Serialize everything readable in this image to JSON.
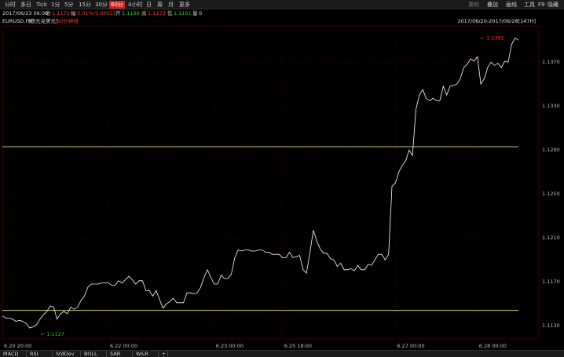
{
  "toolbar": {
    "timeframes": [
      "分时",
      "多日",
      "Tick",
      "1分",
      "5分",
      "15分",
      "30分",
      "60分",
      "4小时",
      "日",
      "周",
      "月",
      "更多"
    ],
    "active_index": 7,
    "right_items": [
      "重权",
      "叠加",
      "画线",
      "工具",
      "F9",
      "隐藏"
    ]
  },
  "info": {
    "datetime": "2017/06/23 06:00",
    "close_label": "收",
    "close_value": "1.1171",
    "change_label": "幅",
    "change_value": "0.01%(0.0001)",
    "open_label": "开",
    "open_value": "1.1169",
    "high_label": "高",
    "high_value": "1.1173",
    "low_label": "低",
    "low_value": "1.1161",
    "volume_label": "量",
    "volume_value": "0"
  },
  "symbol": {
    "code": "EURUSD.FX",
    "name": "[欧元兑美元]",
    "period": "60分钟线"
  },
  "range_text": "2017/06/20-2017/06/28[147H]",
  "chart_data": {
    "type": "line",
    "y_ticks": [
      "1.1370",
      "1.1330",
      "1.1290",
      "1.1250",
      "1.1210",
      "1.1170",
      "1.1130"
    ],
    "x_ticks": [
      "6.20 20:00",
      "6.22 00:00",
      "6.23 00:00",
      "6.25 18:00",
      "6.27 00:00",
      "6.28 00:00"
    ],
    "ylim": [
      1.1118,
      1.1403
    ],
    "high_marker": "1.1392",
    "low_marker": "1.1127",
    "hlines": [
      1.1293,
      1.1144
    ],
    "values": [
      1.1139,
      1.1137,
      1.1137,
      1.1136,
      1.1134,
      1.1135,
      1.1134,
      1.1132,
      1.1128,
      1.1129,
      1.1131,
      1.1136,
      1.114,
      1.1143,
      1.1148,
      1.1147,
      1.1136,
      1.1141,
      1.1143,
      1.1141,
      1.1147,
      1.1145,
      1.1147,
      1.1153,
      1.1157,
      1.1165,
      1.1168,
      1.1168,
      1.1168,
      1.1169,
      1.1169,
      1.1169,
      1.1167,
      1.1167,
      1.1171,
      1.1169,
      1.1172,
      1.1175,
      1.1172,
      1.1168,
      1.1171,
      1.1171,
      1.1162,
      1.1162,
      1.1157,
      1.1162,
      1.1154,
      1.1146,
      1.115,
      1.1152,
      1.1155,
      1.1151,
      1.1151,
      1.1151,
      1.116,
      1.116,
      1.1159,
      1.116,
      1.1165,
      1.1174,
      1.1181,
      1.1174,
      1.1168,
      1.1168,
      1.1176,
      1.1173,
      1.1173,
      1.1177,
      1.1192,
      1.1199,
      1.1198,
      1.1199,
      1.1199,
      1.1198,
      1.1198,
      1.1199,
      1.1199,
      1.1197,
      1.1197,
      1.1195,
      1.1195,
      1.1195,
      1.1192,
      1.1192,
      1.1197,
      1.1192,
      1.1193,
      1.1194,
      1.1181,
      1.1178,
      1.1197,
      1.1217,
      1.1207,
      1.12,
      1.1196,
      1.1196,
      1.1191,
      1.119,
      1.1184,
      1.1187,
      1.1181,
      1.1181,
      1.1182,
      1.118,
      1.1185,
      1.1181,
      1.1181,
      1.1186,
      1.1185,
      1.119,
      1.1195,
      1.1195,
      1.119,
      1.1195,
      1.1257,
      1.126,
      1.127,
      1.1276,
      1.128,
      1.129,
      1.1285,
      1.1327,
      1.134,
      1.1345,
      1.1337,
      1.1335,
      1.1337,
      1.1335,
      1.1335,
      1.1348,
      1.134,
      1.1348,
      1.1349,
      1.135,
      1.1355,
      1.1365,
      1.1368,
      1.1373,
      1.1371,
      1.1375,
      1.135,
      1.1355,
      1.1365,
      1.137,
      1.1367,
      1.1369,
      1.1365,
      1.1371,
      1.137,
      1.1386,
      1.1392,
      1.139
    ]
  },
  "bottom_tabs": [
    "MACD",
    "RSI",
    "StdDev",
    "BOLL",
    "SAR",
    "W&R",
    "+"
  ]
}
